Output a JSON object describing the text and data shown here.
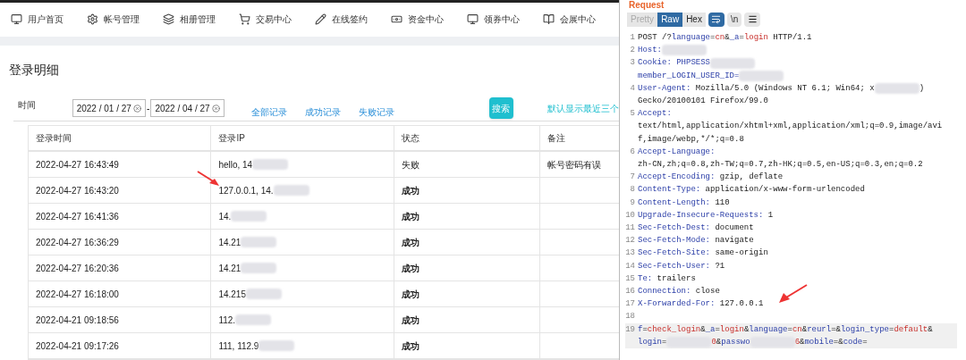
{
  "nav": {
    "items": [
      {
        "label": "用户首页"
      },
      {
        "label": "帐号管理"
      },
      {
        "label": "相册管理"
      },
      {
        "label": "交易中心"
      },
      {
        "label": "在线签约"
      },
      {
        "label": "资金中心"
      },
      {
        "label": "领券中心"
      },
      {
        "label": "会展中心"
      }
    ]
  },
  "page_title": "登录明细",
  "filter": {
    "label": "时间",
    "date_from": "2022 / 01 / 27",
    "separator": "-",
    "date_to": "2022 / 04 / 27",
    "links": [
      "全部记录",
      "成功记录",
      "失败记录"
    ],
    "search_button": "搜索",
    "hint": "默认显示最近三个"
  },
  "table": {
    "columns": [
      "登录时间",
      "登录IP",
      "状态",
      "备注"
    ],
    "rows": [
      {
        "time": "2022-04-27 16:43:49",
        "ip": "hello, 14",
        "status": "失败",
        "success": false,
        "note": "帐号密码有误"
      },
      {
        "time": "2022-04-27 16:43:20",
        "ip": "127.0.0.1, 14.",
        "status": "成功",
        "success": true
      },
      {
        "time": "2022-04-27 16:41:36",
        "ip": "14.",
        "status": "成功",
        "success": true
      },
      {
        "time": "2022-04-27 16:36:29",
        "ip": "14.21",
        "status": "成功",
        "success": true
      },
      {
        "time": "2022-04-27 16:20:36",
        "ip": "14.21",
        "status": "成功",
        "success": true
      },
      {
        "time": "2022-04-27 16:18:00",
        "ip": "14.215",
        "status": "成功",
        "success": true
      },
      {
        "time": "2022-04-21 09:18:56",
        "ip": "112.",
        "status": "成功",
        "success": true
      },
      {
        "time": "2022-04-21 09:17:26",
        "ip": "111, 112.9",
        "status": "成功",
        "success": true
      }
    ]
  },
  "request": {
    "title": "Request",
    "tabs": [
      {
        "label": "Pretty",
        "selected": false,
        "disabled": true
      },
      {
        "label": "Raw",
        "selected": true,
        "disabled": false
      },
      {
        "label": "Hex",
        "selected": false,
        "disabled": false
      }
    ],
    "wrap_button": {
      "selected": true
    },
    "newline_button": {
      "label": "\\n",
      "selected": false
    },
    "lines": [
      {
        "num": "1",
        "segments": [
          {
            "kind": "plain",
            "text": "POST /?"
          },
          {
            "kind": "param",
            "text": "language"
          },
          {
            "kind": "plain",
            "text": "="
          },
          {
            "kind": "val",
            "text": "cn"
          },
          {
            "kind": "plain",
            "text": "&"
          },
          {
            "kind": "param",
            "text": "_a"
          },
          {
            "kind": "plain",
            "text": "="
          },
          {
            "kind": "val",
            "text": "login"
          },
          {
            "kind": "plain",
            "text": " HTTP/1.1"
          }
        ]
      },
      {
        "num": "2",
        "segments": [
          {
            "kind": "key",
            "text": "Host:"
          },
          {
            "kind": "redacted"
          }
        ]
      },
      {
        "num": "3",
        "segments": [
          {
            "kind": "key",
            "text": "Cookie: PHPSESS"
          },
          {
            "kind": "redacted"
          }
        ]
      },
      {
        "segments": [
          {
            "kind": "key",
            "text": "member_LOGIN_USER_ID="
          },
          {
            "kind": "redacted"
          }
        ]
      },
      {
        "num": "4",
        "segments": [
          {
            "kind": "key",
            "text": "User-Agent:"
          },
          {
            "kind": "plain",
            "text": " Mozilla/5.0 (Windows NT 6.1; Win64; x"
          },
          {
            "kind": "redacted"
          },
          {
            "kind": "plain",
            "text": ")"
          }
        ]
      },
      {
        "segments": [
          {
            "kind": "plain",
            "text": "Gecko/20100101 Firefox/99.0"
          }
        ]
      },
      {
        "num": "5",
        "segments": [
          {
            "kind": "key",
            "text": "Accept:"
          }
        ]
      },
      {
        "segments": [
          {
            "kind": "plain",
            "text": "text/html,application/xhtml+xml,application/xml;q=0.9,image/avi"
          }
        ]
      },
      {
        "segments": [
          {
            "kind": "plain",
            "text": "f,image/webp,*/*;q=0.8"
          }
        ]
      },
      {
        "num": "6",
        "segments": [
          {
            "kind": "key",
            "text": "Accept-Language:"
          }
        ]
      },
      {
        "segments": [
          {
            "kind": "plain",
            "text": "zh-CN,zh;q=0.8,zh-TW;q=0.7,zh-HK;q=0.5,en-US;q=0.3,en;q=0.2"
          }
        ]
      },
      {
        "num": "7",
        "segments": [
          {
            "kind": "key",
            "text": "Accept-Encoding:"
          },
          {
            "kind": "plain",
            "text": " gzip, deflate"
          }
        ]
      },
      {
        "num": "8",
        "segments": [
          {
            "kind": "key",
            "text": "Content-Type:"
          },
          {
            "kind": "plain",
            "text": " application/x-www-form-urlencoded"
          }
        ]
      },
      {
        "num": "9",
        "segments": [
          {
            "kind": "key",
            "text": "Content-Length:"
          },
          {
            "kind": "plain",
            "text": " 110"
          }
        ]
      },
      {
        "num": "10",
        "segments": [
          {
            "kind": "key",
            "text": "Upgrade-Insecure-Requests:"
          },
          {
            "kind": "plain",
            "text": " 1"
          }
        ]
      },
      {
        "num": "11",
        "segments": [
          {
            "kind": "key",
            "text": "Sec-Fetch-Dest:"
          },
          {
            "kind": "plain",
            "text": " document"
          }
        ]
      },
      {
        "num": "12",
        "segments": [
          {
            "kind": "key",
            "text": "Sec-Fetch-Mode:"
          },
          {
            "kind": "plain",
            "text": " navigate"
          }
        ]
      },
      {
        "num": "13",
        "segments": [
          {
            "kind": "key",
            "text": "Sec-Fetch-Site:"
          },
          {
            "kind": "plain",
            "text": " same-origin"
          }
        ]
      },
      {
        "num": "14",
        "segments": [
          {
            "kind": "key",
            "text": "Sec-Fetch-User:"
          },
          {
            "kind": "plain",
            "text": " ?1"
          }
        ]
      },
      {
        "num": "15",
        "segments": [
          {
            "kind": "key",
            "text": "Te:"
          },
          {
            "kind": "plain",
            "text": " trailers"
          }
        ]
      },
      {
        "num": "16",
        "segments": [
          {
            "kind": "key",
            "text": "Connection:"
          },
          {
            "kind": "plain",
            "text": " close"
          }
        ]
      },
      {
        "num": "17",
        "segments": [
          {
            "kind": "key",
            "text": "X-Forwarded-For:"
          },
          {
            "kind": "plain",
            "text": " 127.0.0.1"
          }
        ]
      },
      {
        "num": "18"
      },
      {
        "num": "19",
        "highlight": true,
        "segments": [
          {
            "kind": "param",
            "text": "f"
          },
          {
            "kind": "plain",
            "text": "="
          },
          {
            "kind": "val",
            "text": "check_login"
          },
          {
            "kind": "plain",
            "text": "&"
          },
          {
            "kind": "param",
            "text": "_a"
          },
          {
            "kind": "plain",
            "text": "="
          },
          {
            "kind": "val",
            "text": "login"
          },
          {
            "kind": "plain",
            "text": "&"
          },
          {
            "kind": "param",
            "text": "language"
          },
          {
            "kind": "plain",
            "text": "="
          },
          {
            "kind": "val",
            "text": "cn"
          },
          {
            "kind": "plain",
            "text": "&"
          },
          {
            "kind": "param",
            "text": "reurl"
          },
          {
            "kind": "plain",
            "text": "=&"
          },
          {
            "kind": "param",
            "text": "login_type"
          },
          {
            "kind": "plain",
            "text": "="
          },
          {
            "kind": "val",
            "text": "default"
          },
          {
            "kind": "plain",
            "text": "&"
          }
        ]
      },
      {
        "highlight": true,
        "segments": [
          {
            "kind": "param",
            "text": "login"
          },
          {
            "kind": "plain",
            "text": "="
          },
          {
            "kind": "redacted"
          },
          {
            "kind": "val",
            "text": "0"
          },
          {
            "kind": "plain",
            "text": "&"
          },
          {
            "kind": "param",
            "text": "passwo"
          },
          {
            "kind": "redacted"
          },
          {
            "kind": "val",
            "text": "6"
          },
          {
            "kind": "plain",
            "text": "&"
          },
          {
            "kind": "param",
            "text": "mobile"
          },
          {
            "kind": "plain",
            "text": "=&"
          },
          {
            "kind": "param",
            "text": "code"
          },
          {
            "kind": "plain",
            "text": "="
          }
        ]
      }
    ]
  }
}
